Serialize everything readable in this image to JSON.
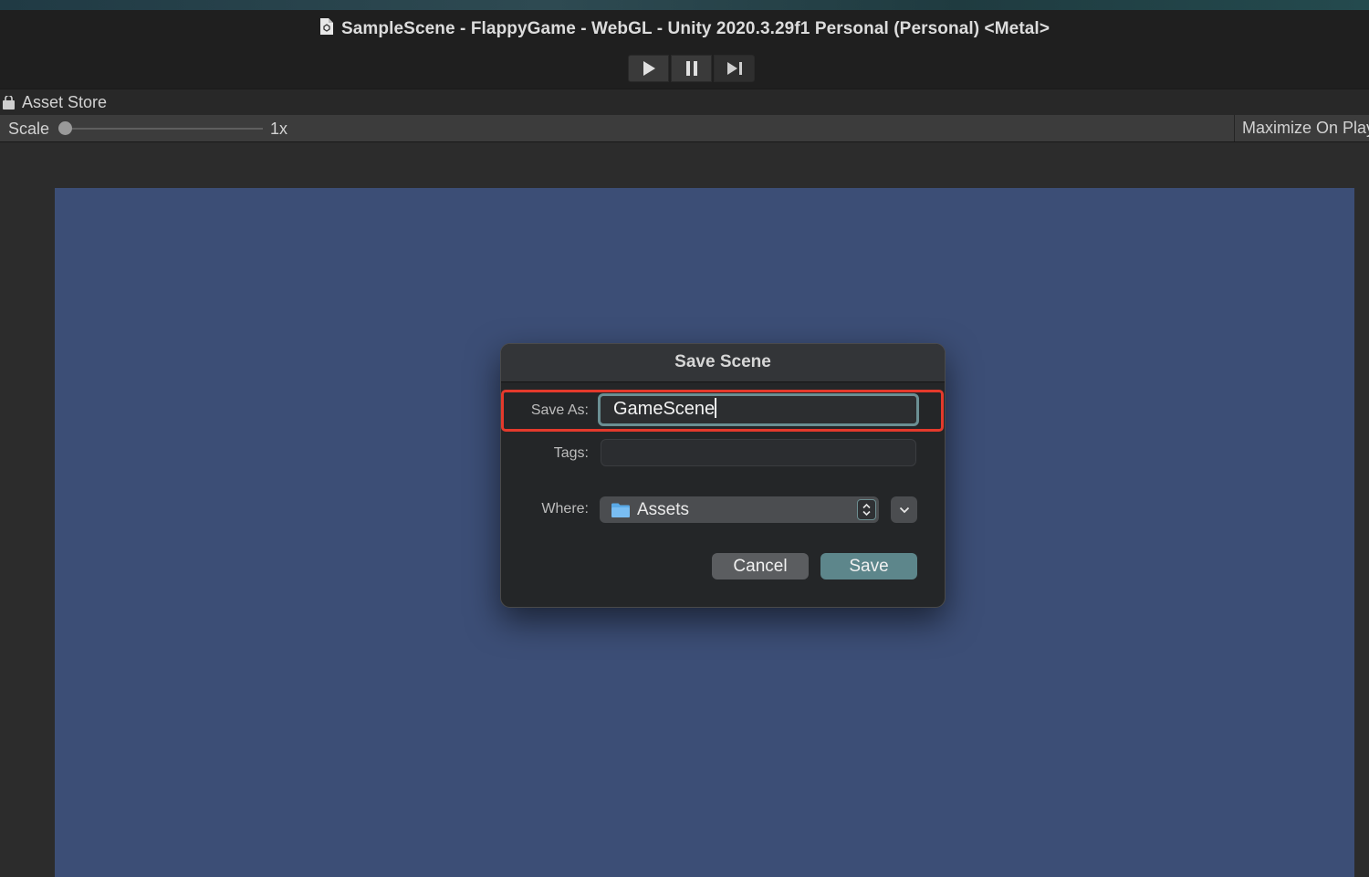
{
  "window": {
    "title": "SampleScene - FlappyGame - WebGL - Unity 2020.3.29f1 Personal (Personal) <Metal>"
  },
  "playbar": {
    "icons": [
      "play-icon",
      "pause-icon",
      "step-icon"
    ]
  },
  "tab": {
    "label": "Asset Store"
  },
  "toolbar": {
    "scale_label": "Scale",
    "scale_value": "1x",
    "maximize_label": "Maximize On Play"
  },
  "dialog": {
    "title": "Save Scene",
    "save_as_label": "Save As:",
    "save_as_value": "GameScene",
    "tags_label": "Tags:",
    "tags_value": "",
    "where_label": "Where:",
    "where_value": "Assets",
    "cancel_label": "Cancel",
    "save_label": "Save"
  },
  "colors": {
    "viewport": "#3c4e76",
    "highlight": "#e43a2c",
    "save_button": "#5d868b"
  }
}
